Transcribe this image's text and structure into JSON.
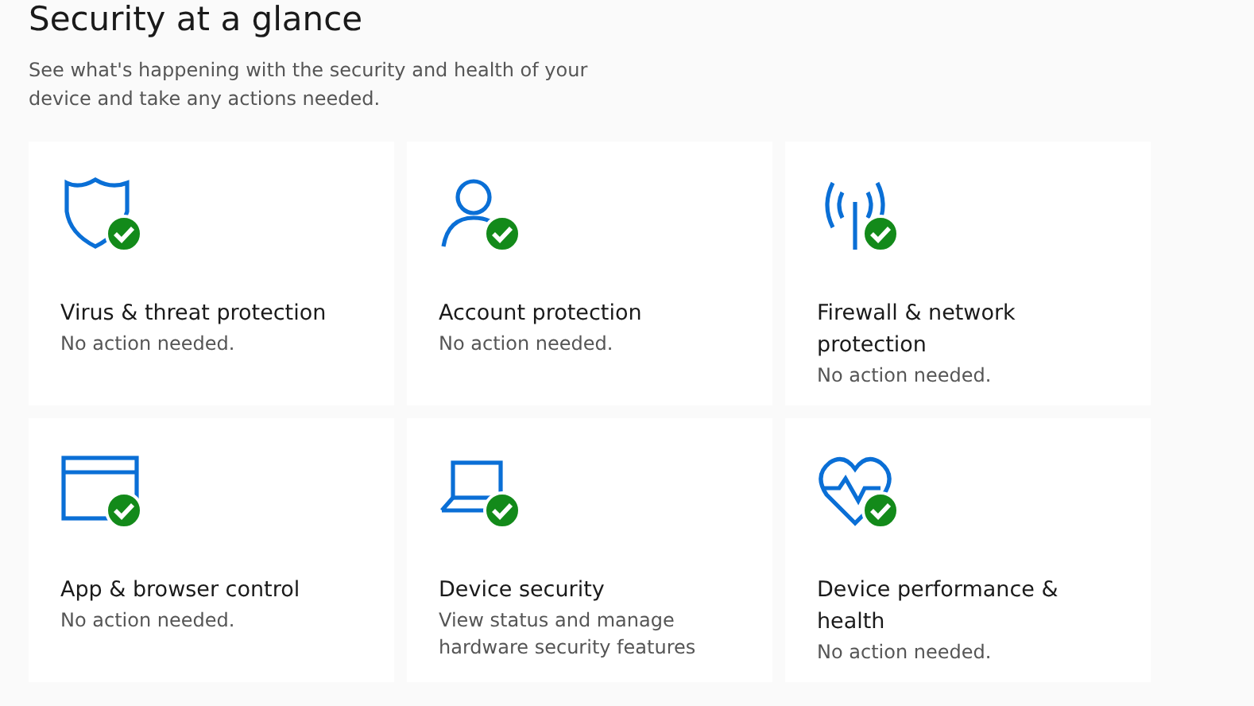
{
  "page": {
    "title": "Security at a glance",
    "subtitle": "See what's happening with the security and health of your device and take any actions needed."
  },
  "cards": [
    {
      "kind": "shield",
      "title": "Virus & threat protection",
      "healthy": true,
      "note": "No action needed."
    },
    {
      "kind": "person",
      "title": "Account protection",
      "healthy": true,
      "note": "No action needed."
    },
    {
      "kind": "antenna",
      "title": "Firewall & network protection",
      "healthy": true,
      "note": "No action needed."
    },
    {
      "kind": "window",
      "title": "App & browser control",
      "healthy": true,
      "note": "No action needed."
    },
    {
      "kind": "laptop",
      "title": "Device security",
      "healthy": true,
      "note": "View status and manage hardware security features"
    },
    {
      "kind": "heart",
      "title": "Device performance & health",
      "healthy": true,
      "note": "No action needed."
    }
  ]
}
